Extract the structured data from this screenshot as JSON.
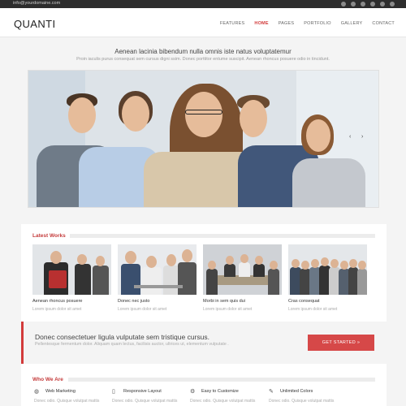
{
  "topbar": {
    "email": "info@yourdomaine.com",
    "social_icons": [
      "rss-icon",
      "twitter-icon",
      "facebook-icon",
      "linkedin-icon",
      "vimeo-icon",
      "flickr-icon"
    ]
  },
  "header": {
    "logo": "QUANTI",
    "nav": [
      "FEATURES",
      "HOME",
      "PAGES",
      "PORTFOLIO",
      "GALLERY",
      "CONTACT"
    ],
    "active_nav": "HOME"
  },
  "intro": {
    "title": "Aenean lacinia bibendum nulla omnis iste natus voluptatemur",
    "subtitle": "Proin iaculis purus consequat sem cursus digni ssim. Donec porttitor entume suscipit. Aenean rhoncus posuere odio in tincidunt."
  },
  "slider": {
    "prev": "‹",
    "next": "›"
  },
  "latest_works": {
    "title": "Latest Works",
    "items": [
      {
        "title": "Aenean rhoncus posuere",
        "subtitle": "Lorem ipsum dolor sit amet"
      },
      {
        "title": "Donec nec justo",
        "subtitle": "Lorem ipsum dolor sit amet"
      },
      {
        "title": "Morbi in sem quis dui",
        "subtitle": "Lorem ipsum dolor sit amet"
      },
      {
        "title": "Cras consequat",
        "subtitle": "Lorem ipsum dolor sit amet"
      }
    ]
  },
  "cta": {
    "title": "Donec consectetuer ligula vulputate sem tristique cursus.",
    "subtitle": "Pellentesque fermentum dolor. Aliquam quam lectus, facilisis auctor, ultrices ut, elementum vulputate .",
    "button": "GET STARTED »"
  },
  "who_we_are": {
    "title": "Who We Are",
    "features": [
      {
        "icon": "globe-icon",
        "glyph": "◍",
        "label": "Web Marketing",
        "desc": "Donec odio. Quisque volutpat mattis"
      },
      {
        "icon": "mobile-icon",
        "glyph": "▯",
        "label": "Responsive Layout",
        "desc": "Donec odio. Quisque volutpat mattis"
      },
      {
        "icon": "gear-icon",
        "glyph": "⚙",
        "label": "Easy to Customize",
        "desc": "Donec odio. Quisque volutpat mattis"
      },
      {
        "icon": "brush-icon",
        "glyph": "✎",
        "label": "Unlimited Colors",
        "desc": "Donec odio. Quisque volutpat mattis"
      }
    ]
  },
  "colors": {
    "accent": "#d23b3b",
    "topbar": "#2d2d2d"
  }
}
